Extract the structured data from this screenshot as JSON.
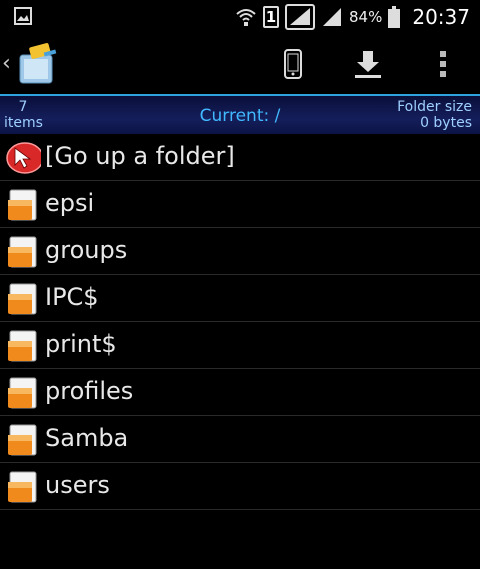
{
  "status_bar": {
    "battery_percent": "84%",
    "time": "20:37",
    "sim_slot": "1",
    "icons": [
      "image-notification-icon",
      "wifi-icon",
      "sim1-icon",
      "signal-icon",
      "signal-icon",
      "battery-icon"
    ]
  },
  "action_bar": {
    "icons": [
      "back-chevron-icon",
      "app-folder-icon",
      "phone-icon",
      "download-icon",
      "overflow-menu-icon"
    ]
  },
  "info_bar": {
    "items_count": "7",
    "items_label": "items",
    "current": "Current: /",
    "folder_size_label": "Folder size",
    "folder_size_value": "0 bytes"
  },
  "files": [
    {
      "label": "[Go up a folder]",
      "icon": "go-up-icon"
    },
    {
      "label": "epsi",
      "icon": "folder-icon"
    },
    {
      "label": "groups",
      "icon": "folder-icon"
    },
    {
      "label": "IPC$",
      "icon": "folder-icon"
    },
    {
      "label": "print$",
      "icon": "folder-icon"
    },
    {
      "label": "profiles",
      "icon": "folder-icon"
    },
    {
      "label": "Samba",
      "icon": "folder-icon"
    },
    {
      "label": "users",
      "icon": "folder-icon"
    }
  ],
  "colors": {
    "accent": "#2fa3e0",
    "path_text": "#41b8ff",
    "folder_orange": "#f08a1c"
  }
}
